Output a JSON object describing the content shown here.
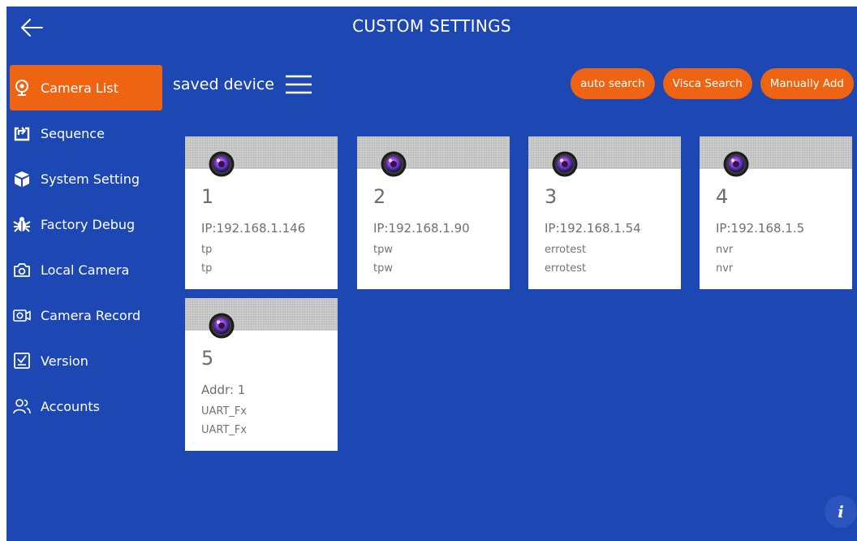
{
  "header": {
    "title": "CUSTOM SETTINGS"
  },
  "sidebar": {
    "items": [
      {
        "label": "Camera List",
        "icon": "webcam-icon",
        "active": true
      },
      {
        "label": "Sequence",
        "icon": "sequence-icon"
      },
      {
        "label": "System Setting",
        "icon": "box-icon"
      },
      {
        "label": "Factory Debug",
        "icon": "bug-icon"
      },
      {
        "label": "Local Camera",
        "icon": "camera-icon"
      },
      {
        "label": "Camera Record",
        "icon": "video-camera-icon"
      },
      {
        "label": "Version",
        "icon": "checkbox-icon"
      },
      {
        "label": "Accounts",
        "icon": "users-icon"
      }
    ]
  },
  "main": {
    "section_title": "saved device",
    "buttons": {
      "auto_search": "auto search",
      "visca_search": "Visca Search",
      "manually_add": "Manually Add"
    },
    "devices": [
      {
        "number": "1",
        "line1": "IP:192.168.1.146",
        "line2": "tp",
        "line3": "tp"
      },
      {
        "number": "2",
        "line1": "IP:192.168.1.90",
        "line2": "tpw",
        "line3": "tpw"
      },
      {
        "number": "3",
        "line1": "IP:192.168.1.54",
        "line2": "errotest",
        "line3": "errotest"
      },
      {
        "number": "4",
        "line1": "IP:192.168.1.5",
        "line2": "nvr",
        "line3": "nvr"
      },
      {
        "number": "5",
        "line1": "Addr: 1",
        "line2": "UART_Fx",
        "line3": "UART_Fx"
      }
    ]
  },
  "info_button": {
    "label": "i"
  },
  "colors": {
    "background": "#1d48b4",
    "accent": "#ee6412",
    "card": "#ffffff",
    "card_header": "#c6c6c6"
  }
}
